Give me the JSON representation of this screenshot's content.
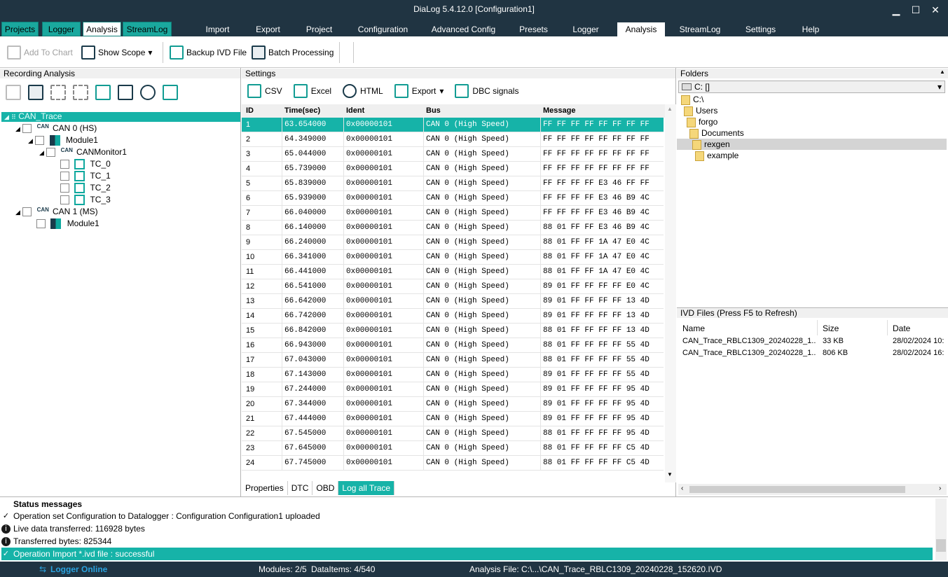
{
  "window": {
    "title": "DiaLog 5.4.12.0    [Configuration1]",
    "min": "▁",
    "max": "☐",
    "close": "✕"
  },
  "left_tabs": [
    "Projects",
    "Logger",
    "Analysis",
    "StreamLog"
  ],
  "menu": [
    "Import",
    "Export",
    "Project",
    "Configuration",
    "Advanced Config",
    "Presets",
    "Logger",
    "Analysis",
    "StreamLog",
    "Settings",
    "Help"
  ],
  "toolbar": {
    "add_to_chart": "Add To Chart",
    "show_scope": "Show Scope",
    "dropdown": "▾",
    "backup": "Backup IVD File",
    "batch": "Batch Processing"
  },
  "recording": {
    "title": "Recording Analysis",
    "tree": {
      "root": "CAN_Trace",
      "can0": "CAN 0 (HS)",
      "module1": "Module1",
      "monitor": "CANMonitor1",
      "tc": [
        "TC_0",
        "TC_1",
        "TC_2",
        "TC_3"
      ],
      "can1": "CAN 1 (MS)",
      "module1b": "Module1",
      "can_label": "CAN"
    }
  },
  "settings": {
    "title": "Settings",
    "csv": "CSV",
    "excel": "Excel",
    "html": "HTML",
    "export": "Export",
    "dbc": "DBC signals",
    "columns": [
      "ID",
      "Time(sec)",
      "Ident",
      "Bus",
      "Message"
    ],
    "rows": [
      [
        "1",
        "63.654000",
        "0x00000101",
        "CAN 0 (High Speed)",
        "FF FF FF FF FF FF FF FF"
      ],
      [
        "2",
        "64.349000",
        "0x00000101",
        "CAN 0 (High Speed)",
        "FF FF FF FF FF FF FF FF"
      ],
      [
        "3",
        "65.044000",
        "0x00000101",
        "CAN 0 (High Speed)",
        "FF FF FF FF FF FF FF FF"
      ],
      [
        "4",
        "65.739000",
        "0x00000101",
        "CAN 0 (High Speed)",
        "FF FF FF FF FF FF FF FF"
      ],
      [
        "5",
        "65.839000",
        "0x00000101",
        "CAN 0 (High Speed)",
        "FF FF FF FF E3 46 FF FF"
      ],
      [
        "6",
        "65.939000",
        "0x00000101",
        "CAN 0 (High Speed)",
        "FF FF FF FF E3 46 B9 4C"
      ],
      [
        "7",
        "66.040000",
        "0x00000101",
        "CAN 0 (High Speed)",
        "FF FF FF FF E3 46 B9 4C"
      ],
      [
        "8",
        "66.140000",
        "0x00000101",
        "CAN 0 (High Speed)",
        "88 01 FF FF E3 46 B9 4C"
      ],
      [
        "9",
        "66.240000",
        "0x00000101",
        "CAN 0 (High Speed)",
        "88 01 FF FF 1A 47 E0 4C"
      ],
      [
        "10",
        "66.341000",
        "0x00000101",
        "CAN 0 (High Speed)",
        "88 01 FF FF 1A 47 E0 4C"
      ],
      [
        "11",
        "66.441000",
        "0x00000101",
        "CAN 0 (High Speed)",
        "88 01 FF FF 1A 47 E0 4C"
      ],
      [
        "12",
        "66.541000",
        "0x00000101",
        "CAN 0 (High Speed)",
        "89 01 FF FF FF FF E0 4C"
      ],
      [
        "13",
        "66.642000",
        "0x00000101",
        "CAN 0 (High Speed)",
        "89 01 FF FF FF FF 13 4D"
      ],
      [
        "14",
        "66.742000",
        "0x00000101",
        "CAN 0 (High Speed)",
        "89 01 FF FF FF FF 13 4D"
      ],
      [
        "15",
        "66.842000",
        "0x00000101",
        "CAN 0 (High Speed)",
        "88 01 FF FF FF FF 13 4D"
      ],
      [
        "16",
        "66.943000",
        "0x00000101",
        "CAN 0 (High Speed)",
        "88 01 FF FF FF FF 55 4D"
      ],
      [
        "17",
        "67.043000",
        "0x00000101",
        "CAN 0 (High Speed)",
        "88 01 FF FF FF FF 55 4D"
      ],
      [
        "18",
        "67.143000",
        "0x00000101",
        "CAN 0 (High Speed)",
        "89 01 FF FF FF FF 55 4D"
      ],
      [
        "19",
        "67.244000",
        "0x00000101",
        "CAN 0 (High Speed)",
        "89 01 FF FF FF FF 95 4D"
      ],
      [
        "20",
        "67.344000",
        "0x00000101",
        "CAN 0 (High Speed)",
        "89 01 FF FF FF FF 95 4D"
      ],
      [
        "21",
        "67.444000",
        "0x00000101",
        "CAN 0 (High Speed)",
        "89 01 FF FF FF FF 95 4D"
      ],
      [
        "22",
        "67.545000",
        "0x00000101",
        "CAN 0 (High Speed)",
        "88 01 FF FF FF FF 95 4D"
      ],
      [
        "23",
        "67.645000",
        "0x00000101",
        "CAN 0 (High Speed)",
        "88 01 FF FF FF FF C5 4D"
      ],
      [
        "24",
        "67.745000",
        "0x00000101",
        "CAN 0 (High Speed)",
        "88 01 FF FF FF FF C5 4D"
      ]
    ],
    "bottom_tabs": [
      "Properties",
      "DTC",
      "OBD",
      "Log all Trace"
    ]
  },
  "folders": {
    "title": "Folders",
    "drive": "C: []",
    "tree": [
      "C:\\",
      "Users",
      "forgo",
      "Documents",
      "rexgen",
      "example"
    ]
  },
  "ivd": {
    "title": "IVD Files (Press F5 to Refresh)",
    "columns": [
      "Name",
      "Size",
      "Date"
    ],
    "rows": [
      [
        "CAN_Trace_RBLC1309_20240228_1...",
        "33 KB",
        "28/02/2024 10:"
      ],
      [
        "CAN_Trace_RBLC1309_20240228_1...",
        "806 KB",
        "28/02/2024 16:"
      ]
    ]
  },
  "status": {
    "title": "Status messages",
    "rows": [
      {
        "icon": "check-icon",
        "text": "Operation set Configuration to Datalogger : Configuration Configuration1 uploaded"
      },
      {
        "icon": "info-icon",
        "text": "Live data transferred: 116928 bytes"
      },
      {
        "icon": "info-icon",
        "text": "Transferred bytes: 825344"
      },
      {
        "icon": "check-icon",
        "text": "Operation Import *.ivd file : successful"
      }
    ]
  },
  "footer": {
    "logger": "Logger Online",
    "modules": "Modules: 2/5",
    "dataitems": "DataItems: 4/540",
    "analysis_file": "Analysis File: C:\\...\\CAN_Trace_RBLC1309_20240228_152620.IVD"
  },
  "colors": {
    "accent": "#16b3a8",
    "dark": "#203442"
  }
}
